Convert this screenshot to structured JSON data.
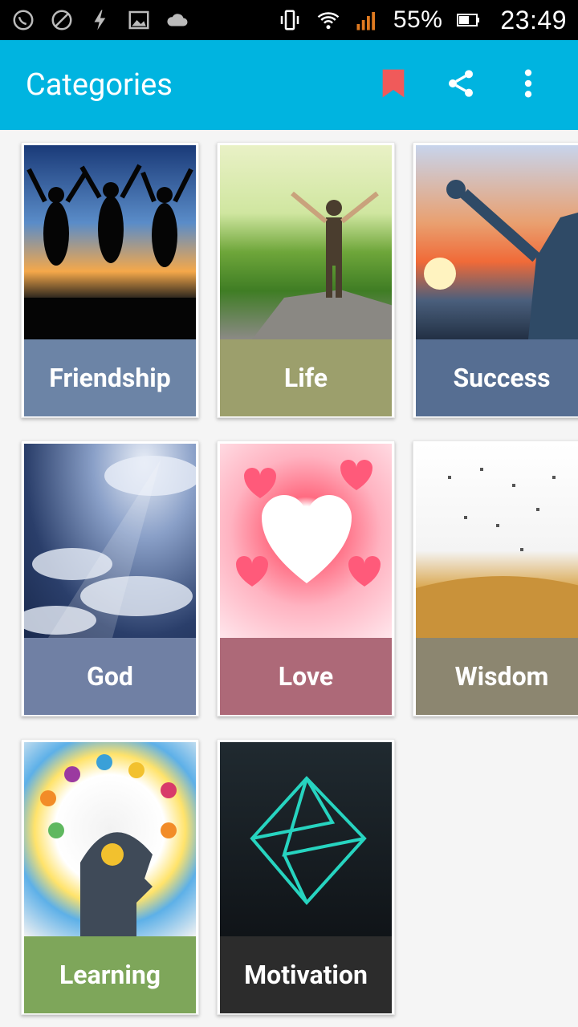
{
  "status_bar": {
    "battery_percent": "55%",
    "time": "23:49",
    "icons": [
      "whatsapp-icon",
      "blocked-icon",
      "flash-icon",
      "image-icon",
      "cloud-icon",
      "vibrate-icon",
      "wifi-icon",
      "signal-icon",
      "battery-icon"
    ]
  },
  "app_bar": {
    "title": "Categories",
    "actions": [
      "bookmark-icon",
      "share-icon",
      "more-vert-icon"
    ],
    "accent": "#00b4e0"
  },
  "categories": [
    {
      "label": "Friendship",
      "color": "#6c84a6"
    },
    {
      "label": "Life",
      "color": "#9c9f6c"
    },
    {
      "label": "Success",
      "color": "#566e92"
    },
    {
      "label": "God",
      "color": "#7080a4"
    },
    {
      "label": "Love",
      "color": "#ad6978"
    },
    {
      "label": "Wisdom",
      "color": "#8c8670"
    },
    {
      "label": "Learning",
      "color": "#7ea65a"
    },
    {
      "label": "Motivation",
      "color": "#2c2c2c"
    }
  ]
}
